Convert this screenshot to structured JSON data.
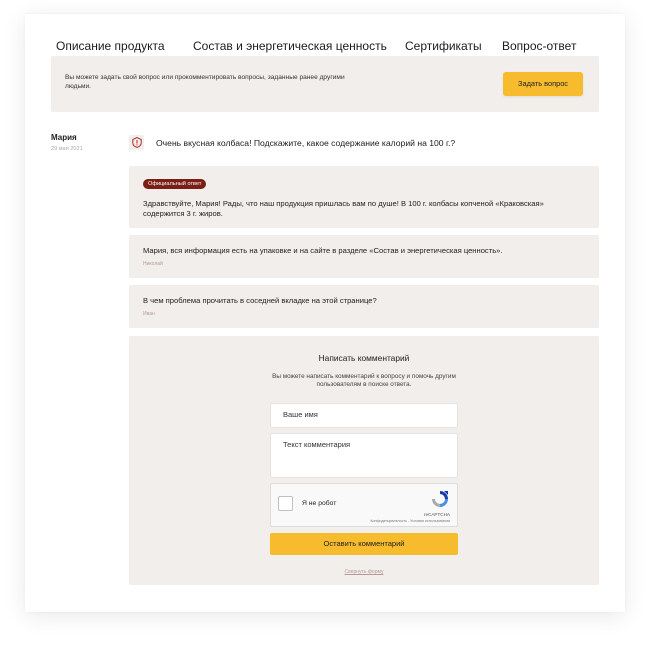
{
  "tabs": [
    {
      "label": "Описание продукта"
    },
    {
      "label": "Состав и энергетическая ценность"
    },
    {
      "label": "Сертификаты"
    },
    {
      "label": "Вопрос-ответ"
    }
  ],
  "info_bar": {
    "text": "Вы можете задать свой вопрос или прокомментировать вопросы, заданные ранее другими людьми.",
    "ask_button_label": "Задать вопрос"
  },
  "question": {
    "author": "Мария",
    "date": "29 мая 2021",
    "icon": "question-shield-icon",
    "text": "Очень вкусная колбаса! Подскажите, какое содержание калорий на 100 г.?"
  },
  "answers": [
    {
      "badge": "Официальный ответ",
      "text": "Здравствуйте, Мария! Рады, что наш продукция пришлась вам по душе! В 100 г. колбасы копченой «Краковская» содержится 3 г. жиров.",
      "author": ""
    },
    {
      "badge": "",
      "text": "Мария, вся информация есть на упаковке и на сайте в разделе «Состав и энергетическая ценность».",
      "author": "Николай"
    },
    {
      "badge": "",
      "text": "В чем проблема прочитать в соседней вкладке на этой странице?",
      "author": "Иван"
    }
  ],
  "comment_form": {
    "title": "Написать комментарий",
    "subtitle": "Вы можете написать комментарий к вопросу и помочь другим пользователям в поиске ответа.",
    "name_placeholder": "Ваше имя",
    "comment_placeholder": "Текст комментария",
    "captcha": {
      "label": "Я не робот",
      "brand": "reCAPTCHA",
      "links": "Конфиденциальность - Условия использования"
    },
    "submit_label": "Оставить комментарий",
    "collapse_label": "Свернуть форму"
  },
  "colors": {
    "accent_yellow": "#f7bb2e",
    "panel_bg": "#f2eeeb",
    "badge_red": "#7b1f16"
  }
}
